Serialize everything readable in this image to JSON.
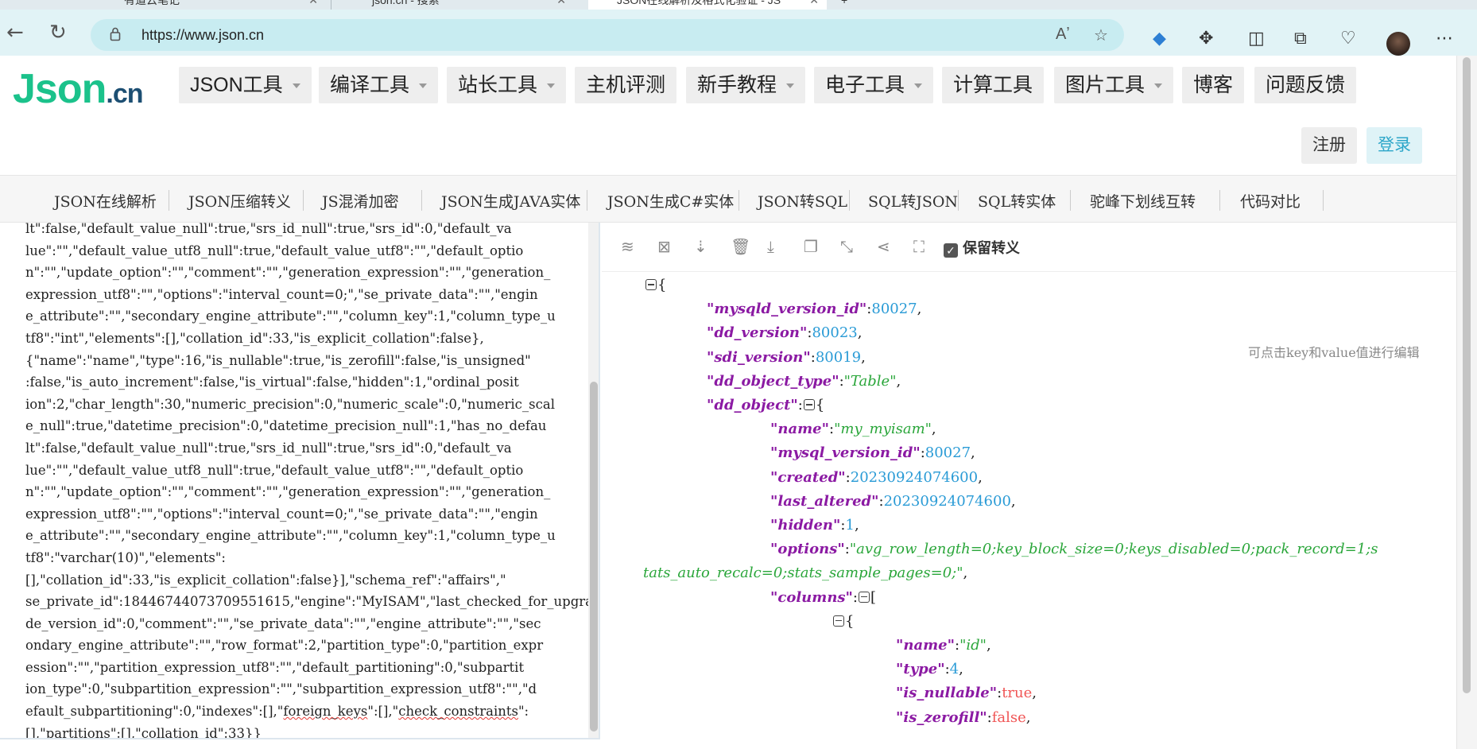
{
  "browser": {
    "tabs": [
      {
        "label": "有道云笔记"
      },
      {
        "label": "json.cn - 搜索"
      },
      {
        "label": "JSON在线解析及格式化验证 - JS"
      }
    ],
    "url": "https://www.json.cn",
    "icons": [
      "back-icon",
      "refresh-icon",
      "lock-icon",
      "read-aloud-icon",
      "favorite-icon",
      "extension-icon",
      "puzzle-icon",
      "split-screen-icon",
      "collections-icon",
      "performance-icon",
      "avatar",
      "more-icon"
    ]
  },
  "site": {
    "logo_main": "Json",
    "logo_suffix": ".cn",
    "menu": [
      {
        "label": "JSON工具",
        "caret": true
      },
      {
        "label": "编译工具",
        "caret": true
      },
      {
        "label": "站长工具",
        "caret": true
      },
      {
        "label": "主机评测",
        "caret": false
      },
      {
        "label": "新手教程",
        "caret": true
      },
      {
        "label": "电子工具",
        "caret": true
      },
      {
        "label": "计算工具",
        "caret": false
      },
      {
        "label": "图片工具",
        "caret": true
      },
      {
        "label": "博客",
        "caret": false
      },
      {
        "label": "问题反馈",
        "caret": false
      }
    ],
    "register_label": "注册",
    "login_label": "登录",
    "subnav": [
      "JSON在线解析",
      "JSON压缩转义",
      "JS混淆加密",
      "JSON生成JAVA实体",
      "JSON生成C#实体",
      "JSON转SQL",
      "SQL转JSON",
      "SQL转实体",
      "驼峰下划线互转",
      "代码对比"
    ]
  },
  "input_text": [
    "lt\":false,\"default_value_null\":true,\"srs_id_null\":true,\"srs_id\":0,\"default_va",
    "lue\":\"\",\"default_value_utf8_null\":true,\"default_value_utf8\":\"\",\"default_optio",
    "n\":\"\",\"update_option\":\"\",\"comment\":\"\",\"generation_expression\":\"\",\"generation_",
    "expression_utf8\":\"\",\"options\":\"interval_count=0;\",\"se_private_data\":\"\",\"engin",
    "e_attribute\":\"\",\"secondary_engine_attribute\":\"\",\"column_key\":1,\"column_type_u",
    "tf8\":\"int\",\"elements\":[],\"collation_id\":33,\"is_explicit_collation\":false},",
    "{\"name\":\"name\",\"type\":16,\"is_nullable\":true,\"is_zerofill\":false,\"is_unsigned\"",
    ":false,\"is_auto_increment\":false,\"is_virtual\":false,\"hidden\":1,\"ordinal_posit",
    "ion\":2,\"char_length\":30,\"numeric_precision\":0,\"numeric_scale\":0,\"numeric_scal",
    "e_null\":true,\"datetime_precision\":0,\"datetime_precision_null\":1,\"has_no_defau",
    "lt\":false,\"default_value_null\":true,\"srs_id_null\":true,\"srs_id\":0,\"default_va",
    "lue\":\"\",\"default_value_utf8_null\":true,\"default_value_utf8\":\"\",\"default_optio",
    "n\":\"\",\"update_option\":\"\",\"comment\":\"\",\"generation_expression\":\"\",\"generation_",
    "expression_utf8\":\"\",\"options\":\"interval_count=0;\",\"se_private_data\":\"\",\"engin",
    "e_attribute\":\"\",\"secondary_engine_attribute\":\"\",\"column_key\":1,\"column_type_u",
    "tf8\":\"varchar(10)\",\"elements\":",
    "[],\"collation_id\":33,\"is_explicit_collation\":false}],\"schema_ref\":\"affairs\",\"",
    "se_private_id\":18446744073709551615,\"engine\":\"MyISAM\",\"last_checked_for_upgra",
    "de_version_id\":0,\"comment\":\"\",\"se_private_data\":\"\",\"engine_attribute\":\"\",\"sec",
    "ondary_engine_attribute\":\"\",\"row_format\":2,\"partition_type\":0,\"partition_expr",
    "ession\":\"\",\"partition_expression_utf8\":\"\",\"default_partitioning\":0,\"subpartit",
    "ion_type\":0,\"subpartition_expression\":\"\",\"subpartition_expression_utf8\":\"\",\"d",
    "efault_subpartitioning\":0,\"indexes\":[],\"foreign_keys\":[],\"check_constraints\":",
    "[],\"partitions\":[],\"collation_id\":33}}"
  ],
  "toolbar": {
    "icons": [
      "database-icon",
      "excel-icon",
      "sort-icon",
      "delete-icon",
      "download-icon",
      "copy-icon",
      "compress-icon",
      "share-icon",
      "fullscreen-icon"
    ],
    "keep_escape_label": "保留转义",
    "keep_escape_checked": true
  },
  "edit_hint": "可点击key和value值进行编辑",
  "json_view": [
    {
      "indent": 0,
      "parts": [
        [
          "fold",
          ""
        ],
        [
          "p",
          "{"
        ]
      ]
    },
    {
      "indent": 1,
      "parts": [
        [
          "k",
          "\"mysqld_version_id\""
        ],
        [
          "p",
          ":"
        ],
        [
          "n",
          "80027"
        ],
        [
          "p",
          ","
        ]
      ]
    },
    {
      "indent": 1,
      "parts": [
        [
          "k",
          "\"dd_version\""
        ],
        [
          "p",
          ":"
        ],
        [
          "n",
          "80023"
        ],
        [
          "p",
          ","
        ]
      ]
    },
    {
      "indent": 1,
      "parts": [
        [
          "k",
          "\"sdi_version\""
        ],
        [
          "p",
          ":"
        ],
        [
          "n",
          "80019"
        ],
        [
          "p",
          ","
        ]
      ]
    },
    {
      "indent": 1,
      "parts": [
        [
          "k",
          "\"dd_object_type\""
        ],
        [
          "p",
          ":"
        ],
        [
          "s",
          "\"Table\""
        ],
        [
          "p",
          ","
        ]
      ]
    },
    {
      "indent": 1,
      "parts": [
        [
          "k",
          "\"dd_object\""
        ],
        [
          "p",
          ":"
        ],
        [
          "fold",
          ""
        ],
        [
          "p",
          "{"
        ]
      ]
    },
    {
      "indent": 2,
      "parts": [
        [
          "k",
          "\"name\""
        ],
        [
          "p",
          ":"
        ],
        [
          "s",
          "\"my_myisam\""
        ],
        [
          "p",
          ","
        ]
      ]
    },
    {
      "indent": 2,
      "parts": [
        [
          "k",
          "\"mysql_version_id\""
        ],
        [
          "p",
          ":"
        ],
        [
          "n",
          "80027"
        ],
        [
          "p",
          ","
        ]
      ]
    },
    {
      "indent": 2,
      "parts": [
        [
          "k",
          "\"created\""
        ],
        [
          "p",
          ":"
        ],
        [
          "n",
          "20230924074600"
        ],
        [
          "p",
          ","
        ]
      ]
    },
    {
      "indent": 2,
      "parts": [
        [
          "k",
          "\"last_altered\""
        ],
        [
          "p",
          ":"
        ],
        [
          "n",
          "20230924074600"
        ],
        [
          "p",
          ","
        ]
      ]
    },
    {
      "indent": 2,
      "parts": [
        [
          "k",
          "\"hidden\""
        ],
        [
          "p",
          ":"
        ],
        [
          "n",
          "1"
        ],
        [
          "p",
          ","
        ]
      ]
    },
    {
      "indent": 2,
      "parts": [
        [
          "k",
          "\"options\""
        ],
        [
          "p",
          ":"
        ],
        [
          "s",
          "\"avg_row_length=0;key_block_size=0;keys_disabled=0;pack_record=1;s"
        ]
      ]
    },
    {
      "indent": 0,
      "parts": [
        [
          "s",
          "tats_auto_recalc=0;stats_sample_pages=0;\""
        ],
        [
          "p",
          ","
        ]
      ]
    },
    {
      "indent": 2,
      "parts": [
        [
          "k",
          "\"columns\""
        ],
        [
          "p",
          ":"
        ],
        [
          "fold",
          ""
        ],
        [
          "p",
          "["
        ]
      ]
    },
    {
      "indent": 3,
      "parts": [
        [
          "fold",
          ""
        ],
        [
          "p",
          "{"
        ]
      ]
    },
    {
      "indent": 4,
      "parts": [
        [
          "k",
          "\"name\""
        ],
        [
          "p",
          ":"
        ],
        [
          "s",
          "\"id\""
        ],
        [
          "p",
          ","
        ]
      ]
    },
    {
      "indent": 4,
      "parts": [
        [
          "k",
          "\"type\""
        ],
        [
          "p",
          ":"
        ],
        [
          "n",
          "4"
        ],
        [
          "p",
          ","
        ]
      ]
    },
    {
      "indent": 4,
      "parts": [
        [
          "k",
          "\"is_nullable\""
        ],
        [
          "p",
          ":"
        ],
        [
          "b",
          "true"
        ],
        [
          "p",
          ","
        ]
      ]
    },
    {
      "indent": 4,
      "parts": [
        [
          "k",
          "\"is_zerofill\""
        ],
        [
          "p",
          ":"
        ],
        [
          "b",
          "false"
        ],
        [
          "p",
          ","
        ]
      ]
    }
  ]
}
